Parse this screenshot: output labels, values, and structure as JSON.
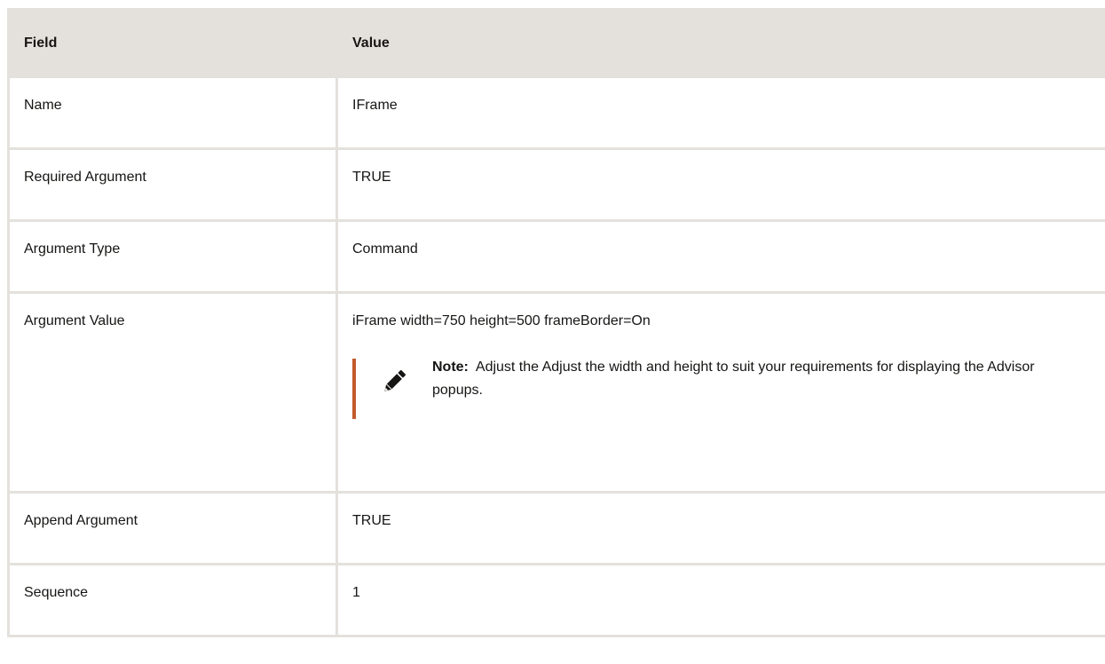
{
  "table": {
    "headers": {
      "field": "Field",
      "value": "Value"
    },
    "rows": [
      {
        "field": "Name",
        "value": "IFrame"
      },
      {
        "field": "Required Argument",
        "value": "TRUE"
      },
      {
        "field": "Argument Type",
        "value": "Command"
      },
      {
        "field": "Argument Value",
        "value": "iFrame width=750 height=500 frameBorder=On"
      },
      {
        "field": "Append Argument",
        "value": "TRUE"
      },
      {
        "field": "Sequence",
        "value": "1"
      }
    ],
    "note": {
      "label": "Note:",
      "text": "Adjust the Adjust the width and height to suit your requirements for displaying the Advisor popups.",
      "icon": "pencil-icon",
      "bar_color": "#c25a2c"
    }
  },
  "colors": {
    "header_bg": "#e4e1dc",
    "border": "#e4e1dc",
    "text": "#161513"
  }
}
